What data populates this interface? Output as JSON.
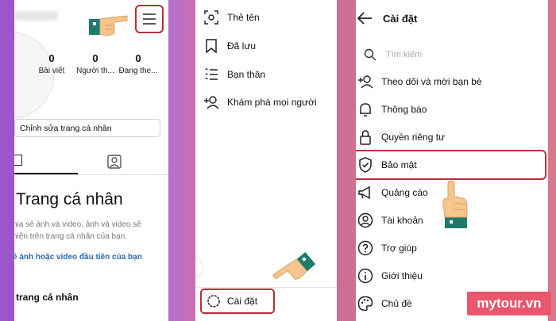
{
  "panel1": {
    "stats": [
      {
        "value": "0",
        "label": "Bài viết"
      },
      {
        "value": "0",
        "label": "Người th..."
      },
      {
        "value": "0",
        "label": "Đang the..."
      }
    ],
    "edit_profile": "Chỉnh sửa trang cá nhân",
    "title": "Trang cá nhân",
    "description": "hia sẻ ảnh và video, ảnh và video sẽ\nhiện trên trang cá nhân của bạn.",
    "link": "ẻ ảnh hoặc video đầu tiên của bạn",
    "bottom_text": "trang cá nhân",
    "icons": {
      "menu": "hamburger-menu-icon",
      "grid": "grid-icon",
      "tagged": "tagged-person-icon"
    }
  },
  "panel2": {
    "items": [
      {
        "label": "Thẻ tên",
        "icon": "name-tag-icon"
      },
      {
        "label": "Đã lưu",
        "icon": "bookmark-icon"
      },
      {
        "label": "Bạn thân",
        "icon": "close-friends-list-icon"
      },
      {
        "label": "Khám phá mọi người",
        "icon": "add-person-icon"
      }
    ],
    "settings_label": "Cài đặt"
  },
  "panel3": {
    "title": "Cài đặt",
    "search_placeholder": "Tìm kiếm",
    "items": [
      {
        "label": "Theo dõi và mời bạn bè",
        "icon": "add-person-icon"
      },
      {
        "label": "Thông báo",
        "icon": "bell-icon"
      },
      {
        "label": "Quyền riêng tư",
        "icon": "lock-icon"
      },
      {
        "label": "Bảo mật",
        "icon": "shield-icon"
      },
      {
        "label": "Quảng cáo",
        "icon": "megaphone-icon"
      },
      {
        "label": "Tài khoản",
        "icon": "account-circle-icon"
      },
      {
        "label": "Trợ giúp",
        "icon": "help-icon"
      },
      {
        "label": "Giới thiệu",
        "icon": "info-icon"
      },
      {
        "label": "Chủ đề",
        "icon": "palette-icon"
      }
    ]
  },
  "watermark": "mytour.vn",
  "colors": {
    "highlight": "#b8303a",
    "link": "#2a6cb1",
    "cuff": "#1e7b6b",
    "skin": "#f4c58c",
    "watermark_bg": "#e9576d"
  }
}
